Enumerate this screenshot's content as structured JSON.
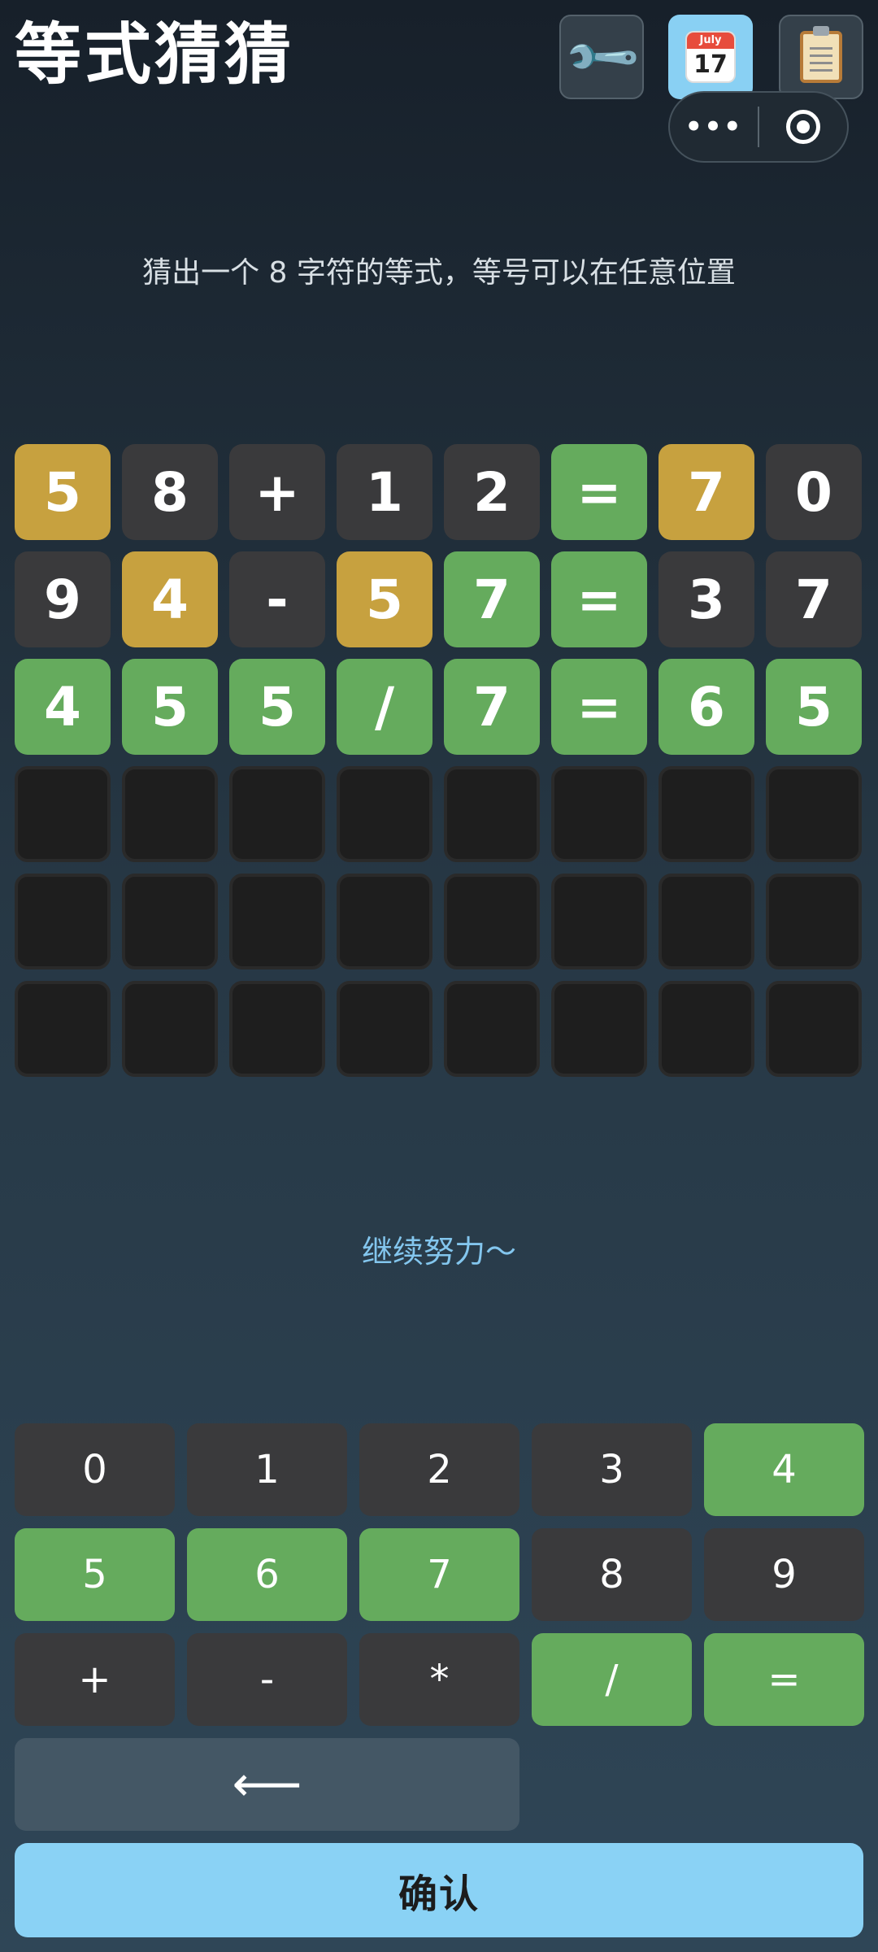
{
  "header": {
    "title": "等式猜猜",
    "settings_icon": "wrench-icon",
    "calendar_icon": "calendar-icon",
    "calendar_month": "July",
    "calendar_day": "17",
    "clipboard_icon": "clipboard-icon",
    "capsule_more": "•••",
    "capsule_close_icon": "target-icon"
  },
  "instruction": "猜出一个 8 字符的等式，等号可以在任意位置",
  "board": {
    "rows": [
      [
        {
          "ch": "5",
          "state": "yellow"
        },
        {
          "ch": "8",
          "state": "gray"
        },
        {
          "ch": "+",
          "state": "gray"
        },
        {
          "ch": "1",
          "state": "gray"
        },
        {
          "ch": "2",
          "state": "gray"
        },
        {
          "ch": "=",
          "state": "green"
        },
        {
          "ch": "7",
          "state": "yellow"
        },
        {
          "ch": "0",
          "state": "gray"
        }
      ],
      [
        {
          "ch": "9",
          "state": "gray"
        },
        {
          "ch": "4",
          "state": "yellow"
        },
        {
          "ch": "-",
          "state": "gray"
        },
        {
          "ch": "5",
          "state": "yellow"
        },
        {
          "ch": "7",
          "state": "green"
        },
        {
          "ch": "=",
          "state": "green"
        },
        {
          "ch": "3",
          "state": "gray"
        },
        {
          "ch": "7",
          "state": "gray"
        }
      ],
      [
        {
          "ch": "4",
          "state": "green"
        },
        {
          "ch": "5",
          "state": "green"
        },
        {
          "ch": "5",
          "state": "green"
        },
        {
          "ch": "/",
          "state": "green"
        },
        {
          "ch": "7",
          "state": "green"
        },
        {
          "ch": "=",
          "state": "green"
        },
        {
          "ch": "6",
          "state": "green"
        },
        {
          "ch": "5",
          "state": "green"
        }
      ],
      [
        {
          "ch": "",
          "state": "empty"
        },
        {
          "ch": "",
          "state": "empty"
        },
        {
          "ch": "",
          "state": "empty"
        },
        {
          "ch": "",
          "state": "empty"
        },
        {
          "ch": "",
          "state": "empty"
        },
        {
          "ch": "",
          "state": "empty"
        },
        {
          "ch": "",
          "state": "empty"
        },
        {
          "ch": "",
          "state": "empty"
        }
      ],
      [
        {
          "ch": "",
          "state": "empty"
        },
        {
          "ch": "",
          "state": "empty"
        },
        {
          "ch": "",
          "state": "empty"
        },
        {
          "ch": "",
          "state": "empty"
        },
        {
          "ch": "",
          "state": "empty"
        },
        {
          "ch": "",
          "state": "empty"
        },
        {
          "ch": "",
          "state": "empty"
        },
        {
          "ch": "",
          "state": "empty"
        }
      ],
      [
        {
          "ch": "",
          "state": "empty"
        },
        {
          "ch": "",
          "state": "empty"
        },
        {
          "ch": "",
          "state": "empty"
        },
        {
          "ch": "",
          "state": "empty"
        },
        {
          "ch": "",
          "state": "empty"
        },
        {
          "ch": "",
          "state": "empty"
        },
        {
          "ch": "",
          "state": "empty"
        },
        {
          "ch": "",
          "state": "empty"
        }
      ]
    ]
  },
  "message": "继续努力～",
  "keyboard": {
    "rows": [
      [
        {
          "label": "0",
          "state": "gray"
        },
        {
          "label": "1",
          "state": "gray"
        },
        {
          "label": "2",
          "state": "gray"
        },
        {
          "label": "3",
          "state": "gray"
        },
        {
          "label": "4",
          "state": "green"
        }
      ],
      [
        {
          "label": "5",
          "state": "green"
        },
        {
          "label": "6",
          "state": "green"
        },
        {
          "label": "7",
          "state": "green"
        },
        {
          "label": "8",
          "state": "gray"
        },
        {
          "label": "9",
          "state": "gray"
        }
      ],
      [
        {
          "label": "+",
          "state": "gray"
        },
        {
          "label": "-",
          "state": "gray"
        },
        {
          "label": "*",
          "state": "gray"
        },
        {
          "label": "/",
          "state": "green"
        },
        {
          "label": "=",
          "state": "green"
        }
      ]
    ],
    "backspace_label": "⟵"
  },
  "confirm_label": "确认",
  "colors": {
    "green": "#65ab5d",
    "yellow": "#c7a13f",
    "gray": "#3a3a3c",
    "empty": "#1e1e1e",
    "accent_blue": "#8ad2f5"
  }
}
